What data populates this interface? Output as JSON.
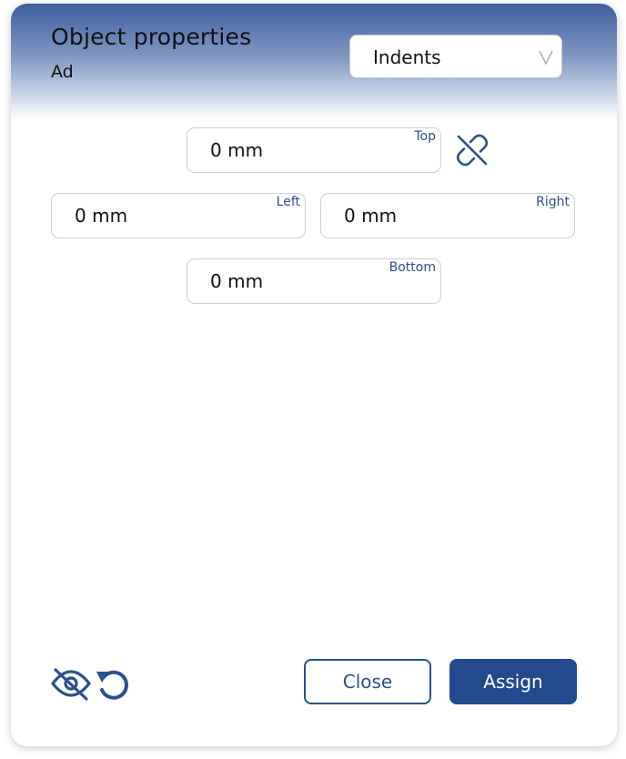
{
  "dialog": {
    "title": "Object properties",
    "subtitle": "Ad"
  },
  "mode_select": {
    "selected": "Indents"
  },
  "indents": {
    "top": {
      "label": "Top",
      "value": "0 mm"
    },
    "left": {
      "label": "Left",
      "value": "0 mm"
    },
    "right": {
      "label": "Right",
      "value": "0 mm"
    },
    "bottom": {
      "label": "Bottom",
      "value": "0 mm"
    }
  },
  "footer": {
    "close_label": "Close",
    "assign_label": "Assign"
  },
  "icons": {
    "link": "unlink-icon",
    "visibility": "eye-off-icon",
    "reset": "undo-icon",
    "dropdown": "chevron-down-icon"
  },
  "colors": {
    "accent": "#234a8e",
    "header_top": "#3d5f9e",
    "label": "#2e4f8e"
  }
}
